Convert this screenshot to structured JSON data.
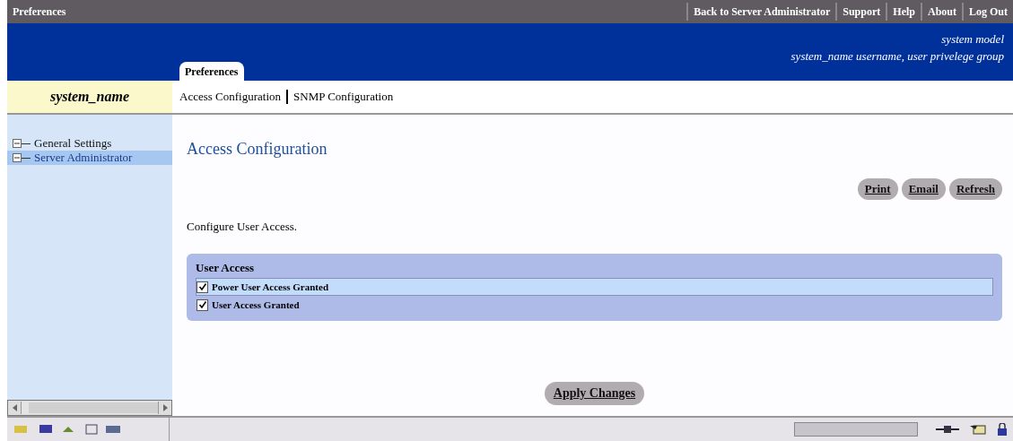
{
  "title_bar": {
    "title": "Preferences",
    "links": [
      "Back to Server Administrator",
      "Support",
      "Help",
      "About",
      "Log Out"
    ]
  },
  "header": {
    "model": "system model",
    "user_line": "system_name username, user privelege group"
  },
  "system_name": "system_name",
  "tab": {
    "label": "Preferences"
  },
  "subnav": [
    "Access Configuration",
    "SNMP Configuration"
  ],
  "tree": [
    {
      "label": "General Settings",
      "expanded": true,
      "selected": false
    },
    {
      "label": "Server Administrator",
      "expanded": true,
      "selected": true
    }
  ],
  "page": {
    "heading": "Access Configuration",
    "actions": [
      "Print",
      "Email",
      "Refresh"
    ],
    "description": "Configure User Access.",
    "group": {
      "title": "User Access",
      "options": [
        {
          "label": "Power User Access Granted",
          "checked": true,
          "selected": true
        },
        {
          "label": "User Access Granted",
          "checked": true,
          "selected": false
        }
      ]
    },
    "apply": "Apply Changes"
  }
}
